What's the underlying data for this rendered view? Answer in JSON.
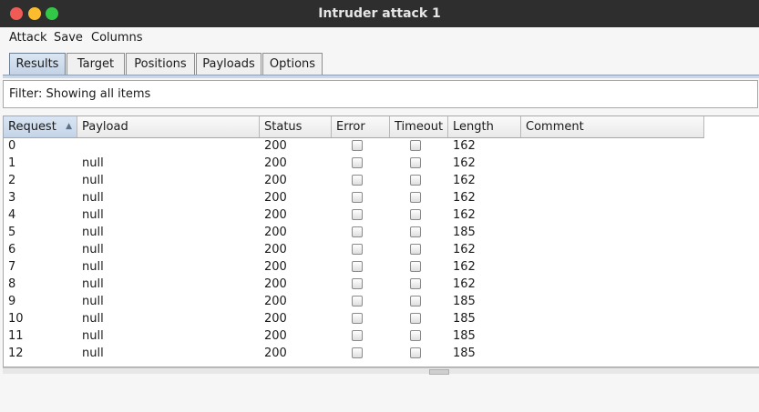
{
  "window": {
    "title": "Intruder attack 1"
  },
  "menu": [
    "Attack",
    "Save",
    "Columns"
  ],
  "tabs": [
    "Results",
    "Target",
    "Positions",
    "Payloads",
    "Options"
  ],
  "active_tab": "Results",
  "filter": {
    "text": "Filter: Showing all items"
  },
  "table": {
    "columns": [
      "Request",
      "Payload",
      "Status",
      "Error",
      "Timeout",
      "Length",
      "Comment"
    ],
    "sorted_column": "Request",
    "sort_direction": "ascending",
    "rows": [
      {
        "request": "0",
        "payload": "",
        "status": "200",
        "error": false,
        "timeout": false,
        "length": "162",
        "comment": ""
      },
      {
        "request": "1",
        "payload": "null",
        "status": "200",
        "error": false,
        "timeout": false,
        "length": "162",
        "comment": ""
      },
      {
        "request": "2",
        "payload": "null",
        "status": "200",
        "error": false,
        "timeout": false,
        "length": "162",
        "comment": ""
      },
      {
        "request": "3",
        "payload": "null",
        "status": "200",
        "error": false,
        "timeout": false,
        "length": "162",
        "comment": ""
      },
      {
        "request": "4",
        "payload": "null",
        "status": "200",
        "error": false,
        "timeout": false,
        "length": "162",
        "comment": ""
      },
      {
        "request": "5",
        "payload": "null",
        "status": "200",
        "error": false,
        "timeout": false,
        "length": "185",
        "comment": ""
      },
      {
        "request": "6",
        "payload": "null",
        "status": "200",
        "error": false,
        "timeout": false,
        "length": "162",
        "comment": ""
      },
      {
        "request": "7",
        "payload": "null",
        "status": "200",
        "error": false,
        "timeout": false,
        "length": "162",
        "comment": ""
      },
      {
        "request": "8",
        "payload": "null",
        "status": "200",
        "error": false,
        "timeout": false,
        "length": "162",
        "comment": ""
      },
      {
        "request": "9",
        "payload": "null",
        "status": "200",
        "error": false,
        "timeout": false,
        "length": "185",
        "comment": ""
      },
      {
        "request": "10",
        "payload": "null",
        "status": "200",
        "error": false,
        "timeout": false,
        "length": "185",
        "comment": ""
      },
      {
        "request": "11",
        "payload": "null",
        "status": "200",
        "error": false,
        "timeout": false,
        "length": "185",
        "comment": ""
      },
      {
        "request": "12",
        "payload": "null",
        "status": "200",
        "error": false,
        "timeout": false,
        "length": "185",
        "comment": ""
      }
    ]
  },
  "colors": {
    "titlebar": "#2e2e2e",
    "close": "#f15b55",
    "minimize": "#fbbc2e",
    "maximize": "#33c748",
    "active_tab": "#c3d3e6"
  }
}
